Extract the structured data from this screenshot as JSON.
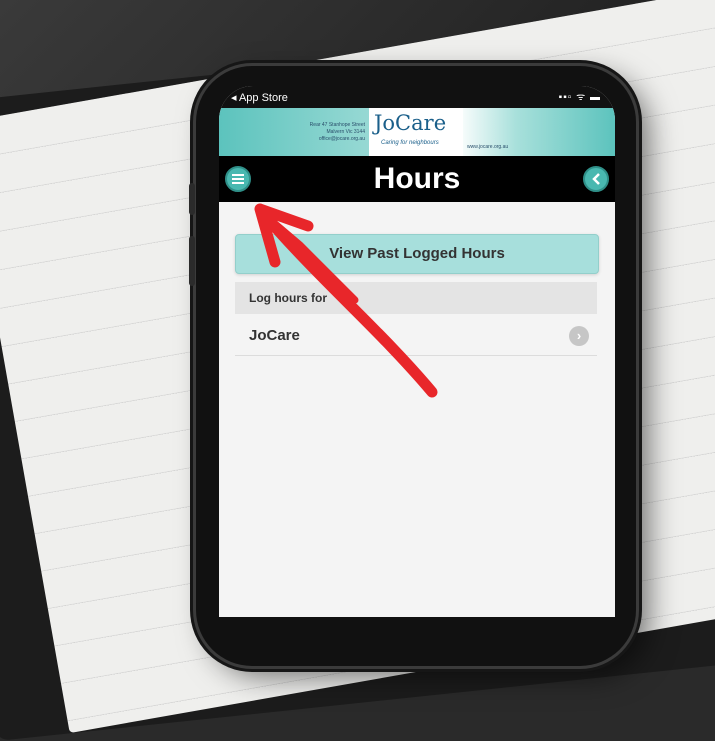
{
  "status_bar": {
    "back_app": "◂ App Store",
    "icons": "▪▪▫ ᯤ ▬"
  },
  "banner": {
    "address": "Rear 47 Stanhope Street\nMalvern Vic 3144\noffice@jocare.org.au",
    "logo": "JoCare",
    "tagline": "Caring for neighbours",
    "website": "www.jocare.org.au"
  },
  "header": {
    "title": "Hours",
    "menu_icon": "menu-icon",
    "back_icon": "back-chevron-icon"
  },
  "main": {
    "past_hours_button": "View Past Logged Hours",
    "log_hours_for_label": "Log hours for",
    "list": [
      {
        "label": "JoCare",
        "icon": "chevron-right-icon"
      }
    ]
  },
  "colors": {
    "accent": "#49b8b0",
    "button_bg": "#a7dfdc",
    "annotation_arrow": "#e8262a"
  }
}
